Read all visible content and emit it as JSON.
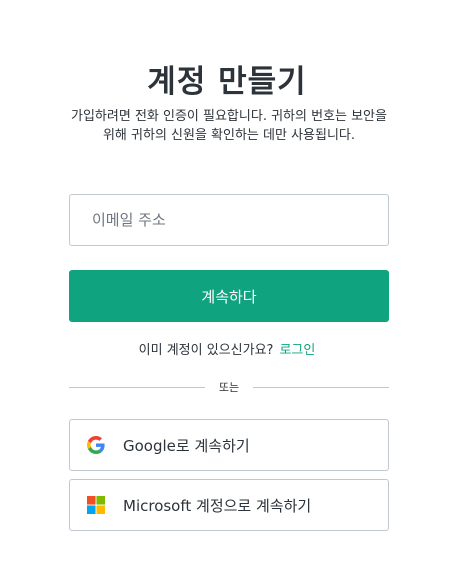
{
  "title": "계정 만들기",
  "subtitle": "가입하려면 전화 인증이 필요합니다. 귀하의 번호는 보안을 위해 귀하의 신원을 확인하는 데만 사용됩니다.",
  "email": {
    "placeholder": "이메일 주소",
    "value": ""
  },
  "continue_label": "계속하다",
  "login_prompt": "이미 계정이 있으신가요?",
  "login_link": "로그인",
  "divider_text": "또는",
  "social": {
    "google_label": "Google로 계속하기",
    "google_icon": "google-logo-icon",
    "microsoft_label": "Microsoft 계정으로 계속하기",
    "microsoft_icon": "microsoft-logo-icon"
  },
  "colors": {
    "accent": "#10a37f",
    "text": "#2d333a",
    "border": "#c2c8d0",
    "ms_red": "#f25022",
    "ms_green": "#7fba00",
    "ms_blue": "#00a4ef",
    "ms_yellow": "#ffb900"
  }
}
